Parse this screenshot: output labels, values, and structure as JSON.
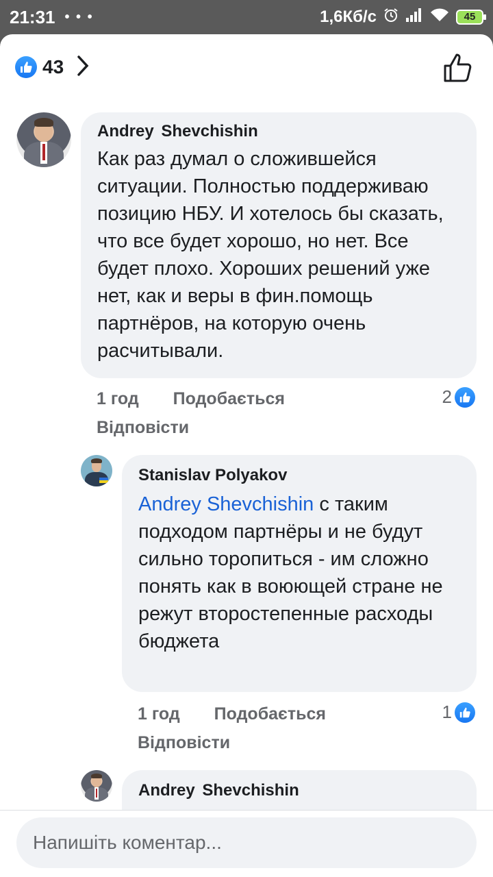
{
  "status_bar": {
    "time": "21:31",
    "dots": "• • •",
    "network_speed": "1,6Кб/с",
    "battery": "45"
  },
  "reactions": {
    "count": "43",
    "icon": "like-icon"
  },
  "comments": [
    {
      "author": "Andrey  Shevchishin",
      "text": "Как раз думал о сложившейся ситуации. Полностью поддерживаю позицию НБУ. И хотелось бы сказать, что все будет хорошо, но нет. Все будет плохо. Хороших решений уже нет, как и веры в фин.помощь партнёров, на которую очень расчитывали.",
      "time": "1 год",
      "like_label": "Подобається",
      "reply_label": "Відповісти",
      "likes": "2"
    },
    {
      "author": "Stanislav Polyakov",
      "mention": "Andrey  Shevchishin",
      "text": " с таким подходом партнёры и не будут сильно торопиться - им сложно понять как в воюющей стране не режут второстепенные расходы бюджета",
      "time": "1 год",
      "like_label": "Подобається",
      "reply_label": "Відповісти",
      "likes": "1"
    },
    {
      "author": "Andrey  Shevchishin"
    }
  ],
  "composer": {
    "placeholder": "Напишіть коментар..."
  },
  "colors": {
    "accent": "#1877f2",
    "mention": "#1a62d6",
    "bubble": "#f0f2f5",
    "muted": "#65676b"
  }
}
